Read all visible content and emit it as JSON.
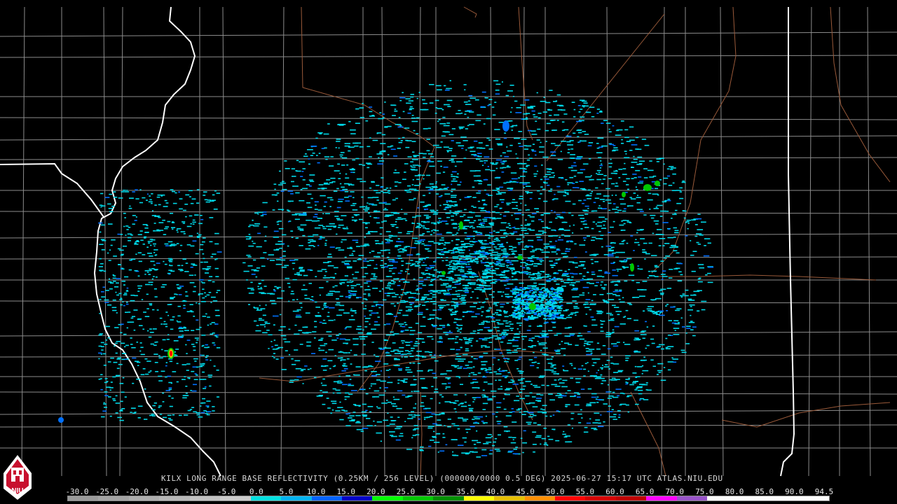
{
  "product": {
    "caption": "KILX LONG RANGE BASE REFLECTIVITY (0.25KM / 256 LEVEL) (000000/0000 0.5 DEG) 2025-06-27 15:17 UTC  ATLAS.NIU.EDU"
  },
  "logo": {
    "text": "NIU",
    "icon": "niu-tower-logo-icon"
  },
  "legend": {
    "ticks": [
      "-30.0",
      "-25.0",
      "-20.0",
      "-15.0",
      "-10.0",
      "-5.0",
      "0.0",
      "5.0",
      "10.0",
      "15.0",
      "20.0",
      "25.0",
      "30.0",
      "35.0",
      "40.0",
      "45.0",
      "50.0",
      "55.0",
      "60.0",
      "65.0",
      "70.0",
      "75.0",
      "80.0",
      "85.0",
      "90.0",
      "94.5"
    ],
    "colors": [
      "#9a9a9a",
      "#a4a4a4",
      "#aeaeae",
      "#b8b8b8",
      "#c2c2c2",
      "#cccccc",
      "#00e0e0",
      "#00b4f0",
      "#0064ff",
      "#0000c8",
      "#00ff00",
      "#00c800",
      "#009000",
      "#ffff00",
      "#e7c000",
      "#ff9000",
      "#ff0000",
      "#d60000",
      "#c00000",
      "#ff00ff",
      "#9955c9",
      "#ffffff",
      "#ffffff",
      "#ffffff",
      "#ffffff"
    ]
  },
  "colors": {
    "background": "#000000",
    "county_lines": "#8c8c8c",
    "state_lines": "#ffffff",
    "highways": "#9a5a3a",
    "weak_echo": "#00d8e8",
    "medium_echo": "#0070ff",
    "strong_echo": "#00c800",
    "heavy_echo": "#ff0000"
  }
}
